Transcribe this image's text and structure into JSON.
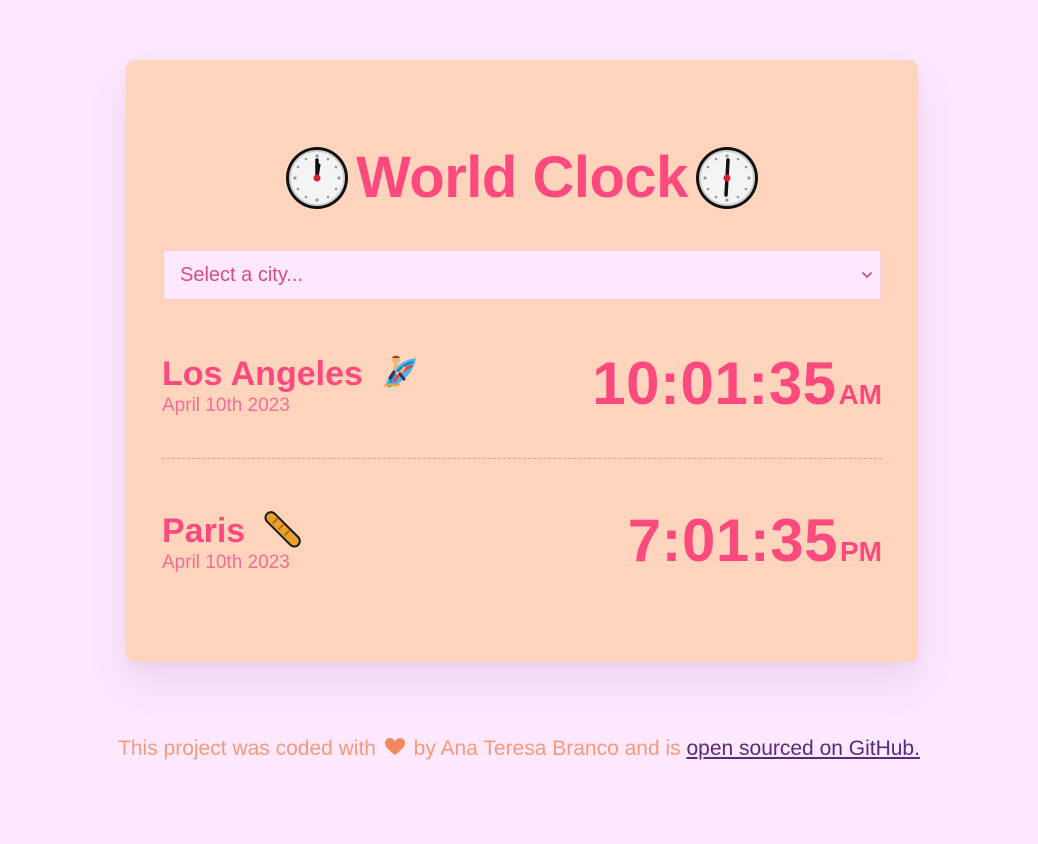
{
  "app": {
    "title": "World Clock",
    "title_icon": "clock-face-12-icon",
    "colors": {
      "background": "#fde8fd",
      "card": "#fed4bd",
      "accent": "#fc4a7f",
      "date": "#f06f99",
      "footer_text": "#f49b7a",
      "link": "#5a2a7c"
    }
  },
  "city_select": {
    "placeholder": "Select a city...",
    "selected": "Select a city..."
  },
  "cities": [
    {
      "name": "Los Angeles",
      "emoji": "surfer-icon",
      "date": "April 10th 2023",
      "time": "10:01:35",
      "ampm": "AM"
    },
    {
      "name": "Paris",
      "emoji": "baguette-icon",
      "date": "April 10th 2023",
      "time": "7:01:35",
      "ampm": "PM"
    }
  ],
  "footer": {
    "text_before": "This project was coded with",
    "heart_icon": "orange-heart-icon",
    "text_after": "by Ana Teresa Branco and is",
    "link_text": "open sourced on GitHub."
  }
}
